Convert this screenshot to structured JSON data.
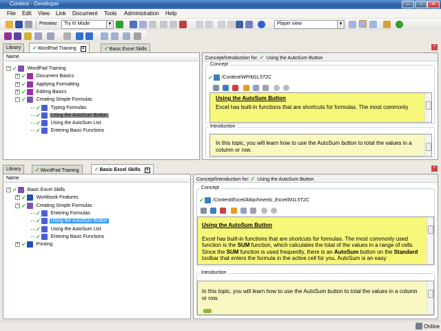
{
  "window": {
    "title": "Content - Developer",
    "buttons": [
      "–",
      "▫",
      "✕"
    ]
  },
  "menu": [
    "File",
    "Edit",
    "View",
    "Link",
    "Document",
    "Tools",
    "Administration",
    "Help"
  ],
  "toolbar": {
    "preview_label": "Preview:",
    "preview_mode": "Try It! Mode",
    "view_mode": "Player view"
  },
  "colors": {
    "titlebar": "#2a5fa8",
    "concept_bg": "#f7f77a",
    "intro_bg": "#f8f8c0",
    "selection": "#3399ff",
    "check": "#22aa22"
  },
  "top": {
    "tabs": [
      {
        "label": "Library"
      },
      {
        "label": "WordPad Training",
        "active": true
      },
      {
        "label": "Basic Excel Skills"
      }
    ],
    "tree_header": "Name",
    "tree": [
      {
        "label": "WordPad Training",
        "level": 0,
        "exp": "−",
        "icon": "book-open"
      },
      {
        "label": "Document Basics",
        "level": 1,
        "exp": "+",
        "icon": "book-purple"
      },
      {
        "label": "Applying Formatting",
        "level": 1,
        "exp": "+",
        "icon": "book-purple"
      },
      {
        "label": "Editing Basics",
        "level": 1,
        "exp": "+",
        "icon": "book-purple"
      },
      {
        "label": "Creating Simple Formulas",
        "level": 1,
        "exp": "−",
        "icon": "book-open"
      },
      {
        "label": "Typing Formulas",
        "level": 2,
        "icon": "topic"
      },
      {
        "label": "Using the AutoSum Button",
        "level": 2,
        "icon": "topic",
        "selected": true
      },
      {
        "label": "Using the AutoSum List",
        "level": 2,
        "icon": "topic"
      },
      {
        "label": "Entering Basic Functions",
        "level": 2,
        "icon": "topic"
      }
    ],
    "header_label": "Concept/Introduction for:",
    "header_item": "Using the AutoSum Button",
    "concept_label": "Concept",
    "concept_path": "/Content/WP/M1L5T2C",
    "concept_title": "Using the AutoSum Button",
    "concept_text": "Excel has built-in functions that are shortcuts for formulas. The most commonly",
    "intro_label": "Introduction",
    "intro_text": "In this topic, you will learn how to use the AutoSum button to total the values in a column or row."
  },
  "bottom": {
    "tabs": [
      {
        "label": "Library"
      },
      {
        "label": "WordPad Training"
      },
      {
        "label": "Basic Excel Skills",
        "active": true
      }
    ],
    "tree_header": "Name",
    "tree": [
      {
        "label": "Basic Excel Skills",
        "level": 0,
        "exp": "−",
        "icon": "book-open"
      },
      {
        "label": "Workbook Features",
        "level": 1,
        "exp": "+",
        "icon": "book-blue"
      },
      {
        "label": "Creating Simple Formulas",
        "level": 1,
        "exp": "−",
        "icon": "book-open"
      },
      {
        "label": "Entering Formulas",
        "level": 2,
        "icon": "topic"
      },
      {
        "label": "Using the AutoSum Button",
        "level": 2,
        "icon": "topic",
        "selected": true
      },
      {
        "label": "Using the AutoSum List",
        "level": 2,
        "icon": "topic"
      },
      {
        "label": "Entering Basic Functions",
        "level": 2,
        "icon": "topic"
      },
      {
        "label": "Printing",
        "level": 1,
        "exp": "+",
        "icon": "book-blue"
      }
    ],
    "header_label": "Concept/Introduction for:",
    "header_item": "Using the AutoSum Button",
    "concept_label": "Concept",
    "concept_path": "/Content/Excel/Attachments_Excel/M1L5T2C",
    "concept_title": "Using the AutoSum Button",
    "concept_parts": [
      [
        "Excel has built-in functions that are shortcuts for formulas. The most commonly used function is the ",
        0
      ],
      [
        "SUM",
        1
      ],
      [
        " function, which calculates the total of the values in a range of cells. Since the ",
        0
      ],
      [
        "SUM",
        1
      ],
      [
        " function is used frequently, there is an ",
        0
      ],
      [
        "AutoSum",
        1
      ],
      [
        " button on the ",
        0
      ],
      [
        "Standard",
        1
      ],
      [
        " toolbar that enters the formula in the active cell for you. AutoSum is an easy",
        0
      ]
    ],
    "intro_label": "Introduction",
    "intro_text": "In this topic, you will learn how to use the AutoSum button to total the values in a column or row."
  },
  "status": {
    "text": "Online"
  }
}
